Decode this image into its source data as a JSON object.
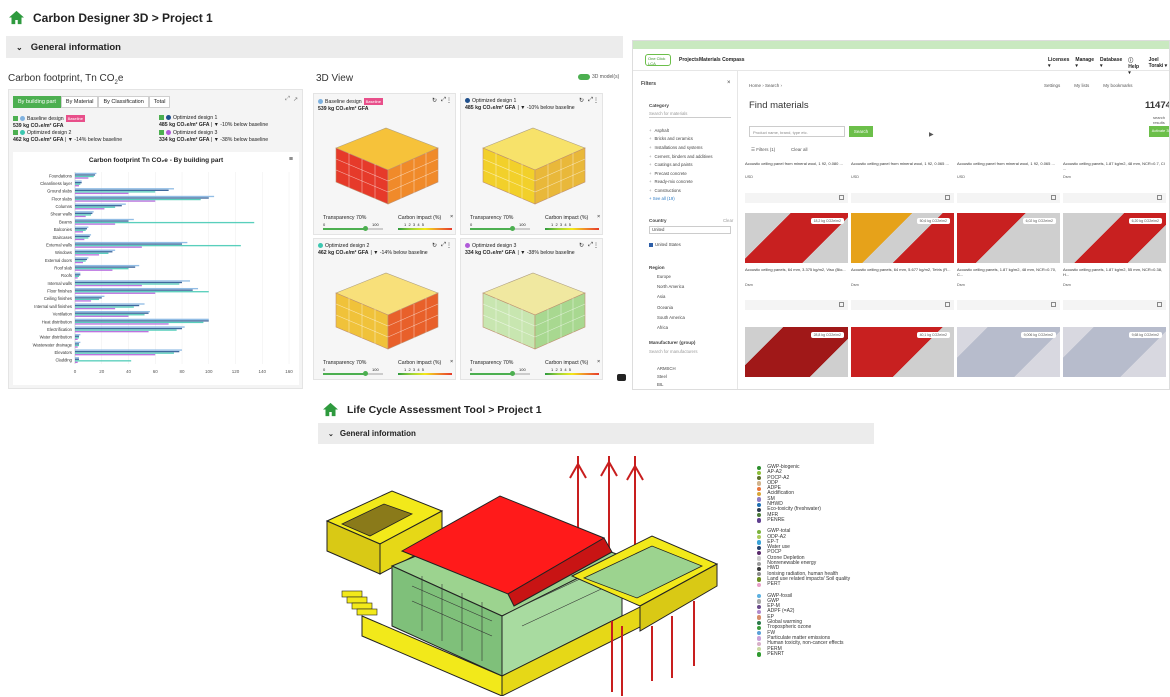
{
  "carbon_designer": {
    "title": "Carbon Designer 3D > Project 1",
    "section": "General information",
    "footprint_heading": "Carbon footprint, Tn CO",
    "footprint_heading_sub": "2",
    "footprint_heading_tail": "e",
    "tabs": [
      "By building part",
      "By Material",
      "By Classification",
      "Total"
    ],
    "designs": [
      {
        "name": "Baseline design",
        "badge": "Baseline",
        "value": "539 kg CO₂e/m² GFA",
        "delta": "",
        "color": "#7fb2e0"
      },
      {
        "name": "Optimized design 1",
        "badge": "",
        "value": "485 kg CO₂e/m² GFA",
        "delta": "| ▼ -10% below baseline",
        "color": "#1e4f8c"
      },
      {
        "name": "Optimized design 2",
        "badge": "",
        "value": "462 kg CO₂e/m² GFA",
        "delta": "| ▼ -14% below baseline",
        "color": "#3cc7b0"
      },
      {
        "name": "Optimized design 3",
        "badge": "",
        "value": "334 kg CO₂e/m² GFA",
        "delta": "| ▼ -38% below baseline",
        "color": "#b05bd9"
      }
    ],
    "view_heading": "3D View",
    "models_toggle_label": "3D model(s)",
    "view_cards": [
      {
        "name": "Baseline design",
        "badge": "Baseline",
        "value": "539 kg CO₂e/m² GFA",
        "delta": "",
        "transparency": "Transparency 70%",
        "impact": "Carbon impact (%)",
        "scale_min": "0",
        "scale_max": "100",
        "impact_ticks": "1  2  3  4  5",
        "dot_color": "#7fb2e0"
      },
      {
        "name": "Optimized design 1",
        "badge": "",
        "value": "485 kg CO₂e/m² GFA",
        "delta": "| ▼ -10% below baseline",
        "transparency": "Transparency 70%",
        "impact": "Carbon impact (%)",
        "scale_min": "0",
        "scale_max": "100",
        "impact_ticks": "1  2  3  4  5",
        "dot_color": "#1e4f8c"
      },
      {
        "name": "Optimized design 2",
        "badge": "",
        "value": "462 kg CO₂e/m² GFA",
        "delta": "| ▼ -14% below baseline",
        "transparency": "Transparency 70%",
        "impact": "Carbon impact (%)",
        "scale_min": "0",
        "scale_max": "100",
        "impact_ticks": "1  2  3  4  5",
        "dot_color": "#3cc7b0"
      },
      {
        "name": "Optimized design 3",
        "badge": "",
        "value": "334 kg CO₂e/m² GFA",
        "delta": "| ▼ -38% below baseline",
        "transparency": "Transparency 70%",
        "impact": "Carbon impact (%)",
        "scale_min": "0",
        "scale_max": "100",
        "impact_ticks": "1  2  3  4  5",
        "dot_color": "#b05bd9"
      }
    ],
    "chart_data": {
      "type": "bar",
      "title": "Carbon footprint Tn CO₂e - By building part",
      "orientation": "horizontal",
      "xlim": [
        0,
        160
      ],
      "xticks": [
        0,
        20,
        40,
        60,
        80,
        100,
        120,
        140,
        160
      ],
      "categories": [
        "Foundations",
        "Cleanliness layer",
        "Ground slabs",
        "Floor slabs",
        "Columns",
        "Shear walls",
        "Beams",
        "Balconies",
        "Staircases",
        "External walls",
        "Windows",
        "External doors",
        "Roof slab",
        "Roofs",
        "Internal walls",
        "Floor finishes",
        "Ceiling finishes",
        "Internal wall finishes",
        "Ventilation",
        "Heat distribution",
        "Electrification",
        "Water distribution",
        "Wastewater drainage",
        "Elevators",
        "Cladding"
      ],
      "series": [
        {
          "name": "Baseline design",
          "color": "#7fb2e0",
          "values": [
            16,
            5,
            74,
            104,
            38,
            14,
            44,
            10,
            12,
            84,
            30,
            10,
            48,
            4,
            86,
            92,
            22,
            52,
            56,
            100,
            82,
            4,
            4,
            80,
            3
          ]
        },
        {
          "name": "Optimized design 1",
          "color": "#1e4f8c",
          "values": [
            15,
            5,
            70,
            100,
            35,
            13,
            40,
            9,
            11,
            80,
            28,
            9,
            45,
            4,
            80,
            88,
            20,
            48,
            55,
            100,
            80,
            3,
            3,
            78,
            3
          ]
        },
        {
          "name": "Optimized design 2",
          "color": "#3cc7b0",
          "values": [
            14,
            4,
            60,
            94,
            30,
            12,
            134,
            8,
            10,
            124,
            25,
            8,
            40,
            3,
            78,
            100,
            18,
            44,
            52,
            96,
            76,
            3,
            3,
            74,
            42
          ]
        },
        {
          "name": "Optimized design 3",
          "color": "#b05bd9",
          "values": [
            10,
            3,
            40,
            60,
            22,
            8,
            30,
            6,
            7,
            50,
            18,
            6,
            28,
            2,
            50,
            60,
            12,
            30,
            40,
            70,
            55,
            2,
            2,
            60,
            2
          ]
        }
      ]
    }
  },
  "one_click": {
    "logo": "One Click LCA",
    "nav": [
      "Projects",
      "Materials Compass"
    ],
    "nav_right": [
      "Licenses ▾",
      "Manage ▾",
      "Database ▾",
      "ⓘ Help ▾",
      "Joel Toraki ▾"
    ],
    "filters_label": "Filters",
    "category_label": "Category",
    "category_search": "Search for materials",
    "categories": [
      "Asphalt",
      "Bricks and ceramics",
      "Installations and systems",
      "Cement, binders and additives",
      "Coatings and paints",
      "Precast concrete",
      "Ready-mix concrete",
      "Constructions"
    ],
    "see_all": "+ See all (19)",
    "country_label": "Country",
    "country_clear": "Clear",
    "country_search": "United",
    "country_selected": "United States",
    "region_label": "Region",
    "regions": [
      "Europe",
      "North America",
      "Asia",
      "Oceania",
      "South America",
      "Africa"
    ],
    "manufacturer_label": "Manufacturer (group)",
    "manufacturer_search": "Search for manufacturers",
    "manufacturers": [
      "ARMSCH",
      "Steel",
      "BIL"
    ],
    "breadcrumb": "Home › Search ›",
    "top_links": [
      "Settings",
      "My lists",
      "My bookmarks"
    ],
    "page_title": "Find materials",
    "result_count": "11474",
    "result_label": "search results",
    "search_placeholder": "Product name, brand, type etc.",
    "search_button": "Search",
    "filters_button": "☰ Filters (1)",
    "clear_all": "Clear all",
    "activate_button": "Activate 3D",
    "top_cards": [
      {
        "name": "Acoustic ceiling panel from mineral wool, 1 92, 0.080 ...",
        "unit": "USD"
      },
      {
        "name": "Acoustic ceiling panel from mineral wool, 1 92, 0.065 ...",
        "unit": "USD"
      },
      {
        "name": "Acoustic ceiling panel from mineral wool, 1 92, 0.065 ...",
        "unit": "USD"
      },
      {
        "name": "Acoustic ceiling panels, 1.87 kg/m2, 48 mm, NCR=0.7, Cl ...",
        "unit": "Dsm"
      }
    ],
    "cards": [
      {
        "badge": "18,2 kg CO2e/m2",
        "name": "Acoustic ceiling panels, 64 mm, 3.375 kg/m2, Viso (Bio...",
        "unit": "Dsm"
      },
      {
        "badge": "50,6 kg CO2e/m2",
        "name": "Acoustic ceiling panels, 64 mm, 5.677 kg/m2, Tetris (R...",
        "unit": "Dsm"
      },
      {
        "badge": "6,02 kg CO2e/m2",
        "name": "Acoustic ceiling panels, 1.87 kg/m2, 48 mm, NCR=0.70, C...",
        "unit": "Dsm"
      },
      {
        "badge": "6,20 kg CO2e/m2",
        "name": "Acoustic ceiling panels, 1.87 kg/m2, 55 mm, NCR=0.38, H...",
        "unit": "Dsm"
      },
      {
        "badge": "28,8 kg CO2e/m2",
        "name": "",
        "unit": ""
      },
      {
        "badge": "40,1 kg CO2e/m2",
        "name": "",
        "unit": ""
      },
      {
        "badge": "9,006 kg CO2e/m2",
        "name": "",
        "unit": ""
      },
      {
        "badge": "9,68 kg CO2e/m2",
        "name": "",
        "unit": ""
      }
    ]
  },
  "lca_tool": {
    "title": "Life Cycle Assessment Tool > Project 1",
    "section": "General information",
    "legend_groups": [
      [
        {
          "label": "GWP-biogenic",
          "color": "#2d8f2d"
        },
        {
          "label": "AP-A2",
          "color": "#8fbf3a"
        },
        {
          "label": "POCP-A2",
          "color": "#5a6e2a"
        },
        {
          "label": "ODP",
          "color": "#d2b48c"
        },
        {
          "label": "ADPE",
          "color": "#e8743b"
        },
        {
          "label": "Acidification",
          "color": "#d9a63a"
        },
        {
          "label": "SM",
          "color": "#8e7cc3"
        },
        {
          "label": "NHWD",
          "color": "#1f6fb2"
        },
        {
          "label": "Eco-toxicity (freshwater)",
          "color": "#2f3b4f"
        },
        {
          "label": "MFR",
          "color": "#4a7a3a"
        },
        {
          "label": "PENRE",
          "color": "#5f3f8f"
        }
      ],
      [
        {
          "label": "GWP-total",
          "color": "#7bb33c"
        },
        {
          "label": "ODP-A2",
          "color": "#aac95a"
        },
        {
          "label": "EP-T",
          "color": "#3aa3d8"
        },
        {
          "label": "Water use",
          "color": "#25406b"
        },
        {
          "label": "POCP",
          "color": "#5a2a6b"
        },
        {
          "label": "Ozone Depletion",
          "color": "#c9c9c9"
        },
        {
          "label": "Nonrenewable energy",
          "color": "#9e9e9e"
        },
        {
          "label": "HWD",
          "color": "#3a3a3a"
        },
        {
          "label": "Ionising radiation, human health",
          "color": "#8c8c8c"
        },
        {
          "label": "Land use related impacts/ Soil quality",
          "color": "#6b8e23"
        },
        {
          "label": "PERT",
          "color": "#e8a0c8"
        }
      ],
      [
        {
          "label": "GWP-fossil",
          "color": "#5cb0e0"
        },
        {
          "label": "GWP",
          "color": "#a7a7a7"
        },
        {
          "label": "EP-M",
          "color": "#6a4a8a"
        },
        {
          "label": "ADPF (=A2)",
          "color": "#b08acb"
        },
        {
          "label": "EP",
          "color": "#d78c6a"
        },
        {
          "label": "Global warming",
          "color": "#2a7a4a"
        },
        {
          "label": "Tropospheric ozone",
          "color": "#3a9a3a"
        },
        {
          "label": "FW",
          "color": "#5aa0d8"
        },
        {
          "label": "Particulate matter emissions",
          "color": "#c8a0d8"
        },
        {
          "label": "Human toxicity, non-cancer effects",
          "color": "#d8b0c8"
        },
        {
          "label": "PERM",
          "color": "#c8d8a0"
        },
        {
          "label": "PENRT",
          "color": "#2f9a2f"
        }
      ]
    ]
  },
  "colors": {
    "brand_green": "#4caf50",
    "house_green": "#2e9a3e",
    "roof_red": "#ff1a1a",
    "wall_yellow": "#f2e91a",
    "wall_green": "#9cd38f"
  }
}
